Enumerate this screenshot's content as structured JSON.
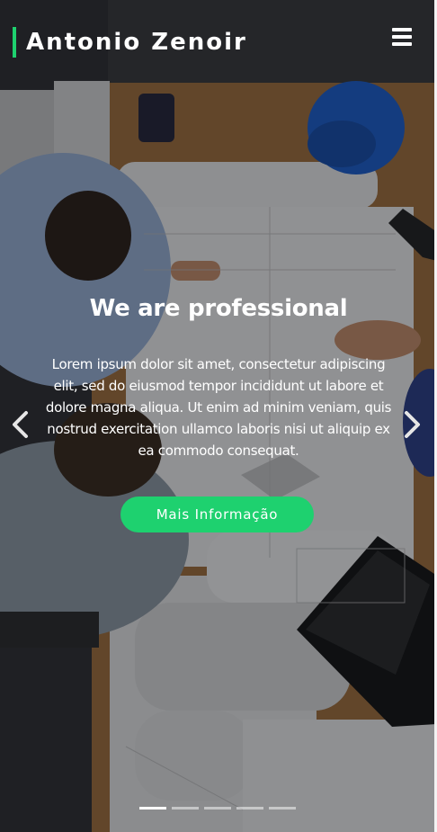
{
  "header": {
    "brand": "Antonio Zenoir",
    "menu_icon": "hamburger-menu-icon"
  },
  "slide": {
    "title": "We are professional",
    "text": "Lorem ipsum dolor sit amet, consectetur adipiscing elit, sed do eiusmod tempor incididunt ut labore et dolore magna aliqua. Ut enim ad minim veniam, quis nostrud exercitation ullamco laboris nisi ut aliquip ex ea commodo consequat.",
    "button_label": "Mais Informação"
  },
  "carousel": {
    "prev_icon": "chevron-left-icon",
    "next_icon": "chevron-right-icon",
    "indicator_count": 5,
    "active_index": 0
  },
  "colors": {
    "accent": "#1ed16f",
    "overlay": "#0a0c10",
    "text": "#ffffff"
  }
}
